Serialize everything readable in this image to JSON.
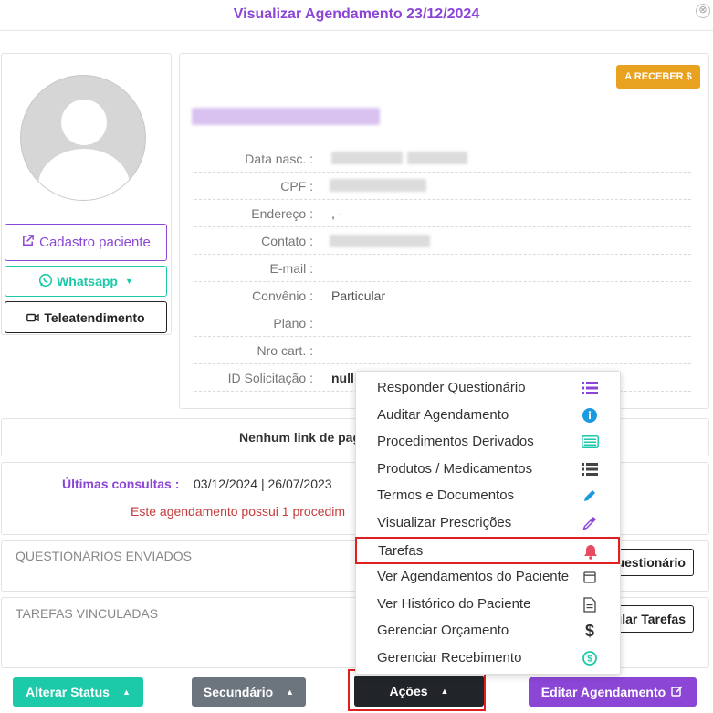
{
  "modal": {
    "title": "Visualizar Agendamento 23/12/2024",
    "close": "⊗"
  },
  "patient": {
    "cadastro_label": "Cadastro paciente",
    "whatsapp_label": "Whatsapp",
    "tele_label": "Teleatendimento",
    "status_badge": "A RECEBER $",
    "fields": [
      {
        "label": "Data nasc. :",
        "value": ""
      },
      {
        "label": "CPF :",
        "value": ""
      },
      {
        "label": "Endereço :",
        "value": ", -"
      },
      {
        "label": "Contato :",
        "value": ""
      },
      {
        "label": "E-mail :",
        "value": ""
      },
      {
        "label": "Convênio :",
        "value": "Particular"
      },
      {
        "label": "Plano :",
        "value": ""
      },
      {
        "label": "Nro cart. :",
        "value": ""
      },
      {
        "label": "ID Solicitação :",
        "value": "null"
      }
    ]
  },
  "info": {
    "link_text": "Nenhum link de pag",
    "ultimas_label": "Últimas consultas :",
    "ultimas_value": "03/12/2024  |  26/07/2023",
    "warning": "Este agendamento possui 1 procedim"
  },
  "sections": {
    "questionarios_title": "QUESTIONÁRIOS ENVIADOS",
    "questionarios_btn": "uestionário",
    "tarefas_title": "TAREFAS VINCULADAS",
    "tarefas_btn": "ular Tarefas"
  },
  "menu": {
    "items": [
      {
        "label": "Responder Questionário",
        "icon": "list-icon",
        "color": "#8b46d6"
      },
      {
        "label": "Auditar Agendamento",
        "icon": "info-icon",
        "color": "#1a9be0"
      },
      {
        "label": "Procedimentos Derivados",
        "icon": "card-list-icon",
        "color": "#1cc9a8"
      },
      {
        "label": "Produtos / Medicamentos",
        "icon": "list-icon",
        "color": "#444444"
      },
      {
        "label": "Termos e Documentos",
        "icon": "pencil-icon",
        "color": "#1a9be0"
      },
      {
        "label": "Visualizar Prescrições",
        "icon": "eyedropper-icon",
        "color": "#8b46d6"
      },
      {
        "label": "Tarefas",
        "icon": "bell-icon",
        "color": "#e84a5f"
      },
      {
        "label": "Ver Agendamentos do Paciente",
        "icon": "calendar-icon",
        "color": "#444444"
      },
      {
        "label": "Ver Histórico do Paciente",
        "icon": "document-icon",
        "color": "#444444"
      },
      {
        "label": "Gerenciar Orçamento",
        "icon": "dollar-icon",
        "color": "#333333"
      },
      {
        "label": "Gerenciar Recebimento",
        "icon": "coin-icon",
        "color": "#1cc9a8"
      }
    ]
  },
  "footer": {
    "alterar_status": "Alterar Status",
    "secundario": "Secundário",
    "acoes": "Ações",
    "editar": "Editar Agendamento"
  },
  "colors": {
    "primary": "#8b46d6",
    "teal": "#1cc9a8",
    "gray": "#6c757d",
    "dark": "#212529",
    "warning": "#e8a21f",
    "highlight": "#e02020"
  }
}
